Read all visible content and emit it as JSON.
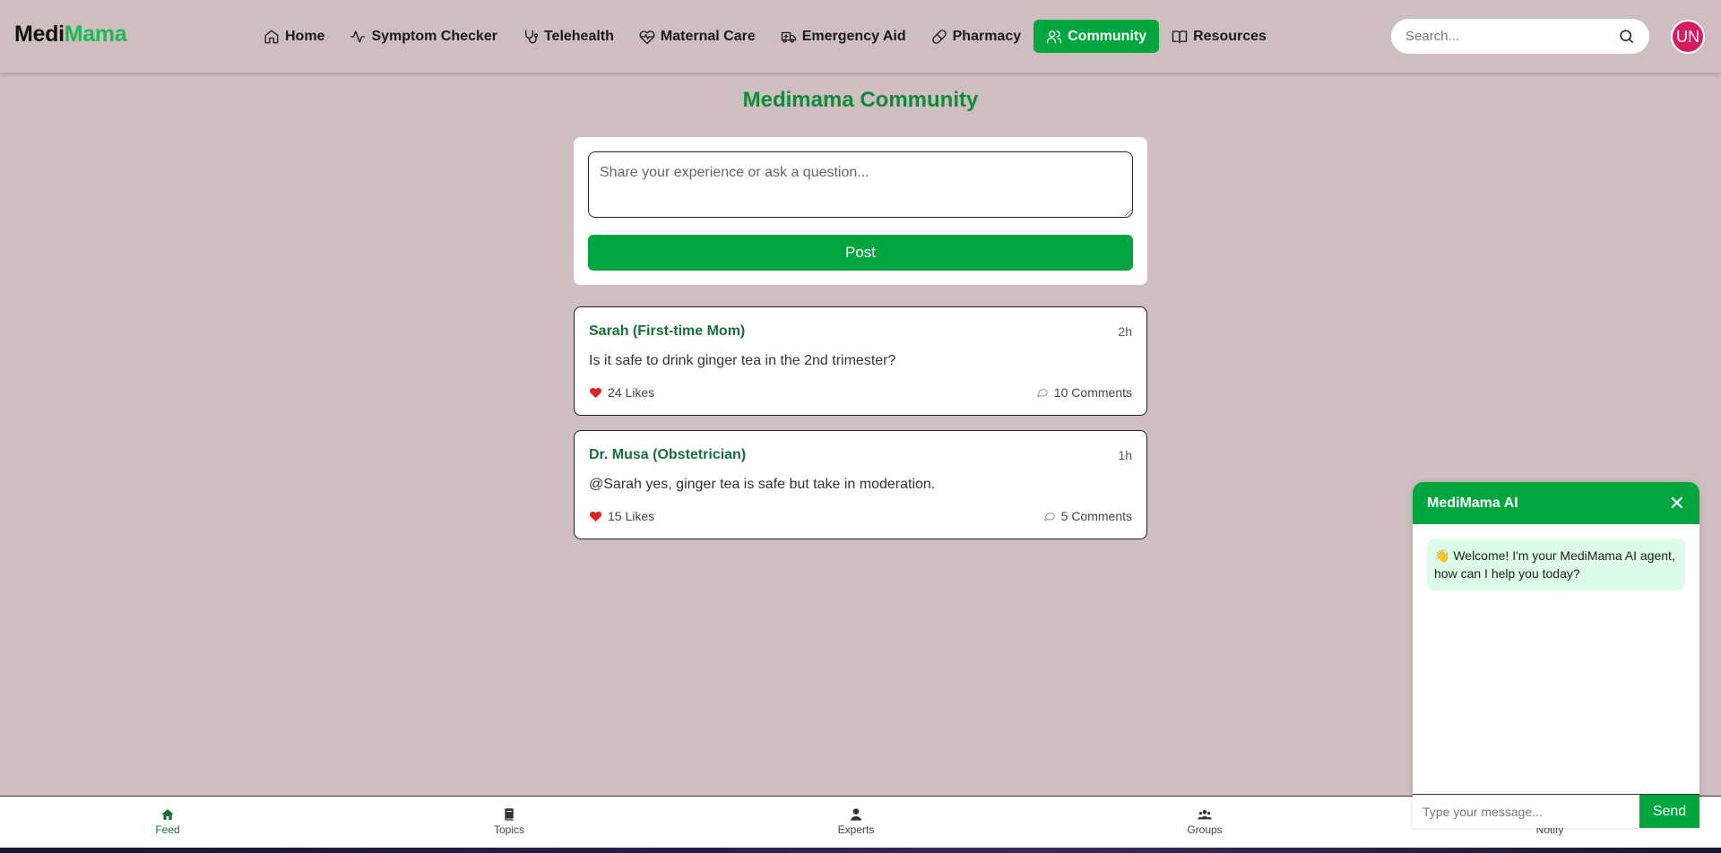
{
  "header": {
    "logo_part1": "Medi",
    "logo_part2": "Mama",
    "nav": [
      {
        "label": "Home",
        "icon": "home-icon"
      },
      {
        "label": "Symptom Checker",
        "icon": "activity-icon"
      },
      {
        "label": "Telehealth",
        "icon": "stethoscope-icon"
      },
      {
        "label": "Maternal Care",
        "icon": "heart-pulse-icon"
      },
      {
        "label": "Emergency Aid",
        "icon": "ambulance-icon"
      },
      {
        "label": "Pharmacy",
        "icon": "pill-icon"
      },
      {
        "label": "Community",
        "icon": "users-icon",
        "active": true
      },
      {
        "label": "Resources",
        "icon": "book-open-icon"
      }
    ],
    "search_placeholder": "Search...",
    "avatar_initials": "UN"
  },
  "main": {
    "title": "Medimama Community",
    "composer_placeholder": "Share your experience or ask a question...",
    "post_button": "Post",
    "posts": [
      {
        "author": "Sarah (First-time Mom)",
        "time": "2h",
        "body": "Is it safe to drink ginger tea in the 2nd trimester?",
        "likes": "24 Likes",
        "comments": "10 Comments"
      },
      {
        "author": "Dr. Musa (Obstetrician)",
        "time": "1h",
        "body": "@Sarah yes, ginger tea is safe but take in moderation.",
        "likes": "15 Likes",
        "comments": "5 Comments"
      }
    ]
  },
  "chat": {
    "title": "MediMama AI",
    "close": "✕",
    "welcome": "👋 Welcome! I'm your MediMama AI agent, how can I help you today?",
    "input_placeholder": "Type your message...",
    "send": "Send"
  },
  "bottom_nav": [
    {
      "label": "Feed",
      "icon": "home-icon",
      "active": true
    },
    {
      "label": "Topics",
      "icon": "book-icon"
    },
    {
      "label": "Experts",
      "icon": "doctor-icon"
    },
    {
      "label": "Groups",
      "icon": "users-icon"
    },
    {
      "label": "Notify",
      "icon": "bell-icon"
    }
  ],
  "colors": {
    "accent": "#00a63e",
    "background": "#cebebf",
    "avatar": "#d81b60",
    "chat_bubble": "#dcfce7"
  }
}
